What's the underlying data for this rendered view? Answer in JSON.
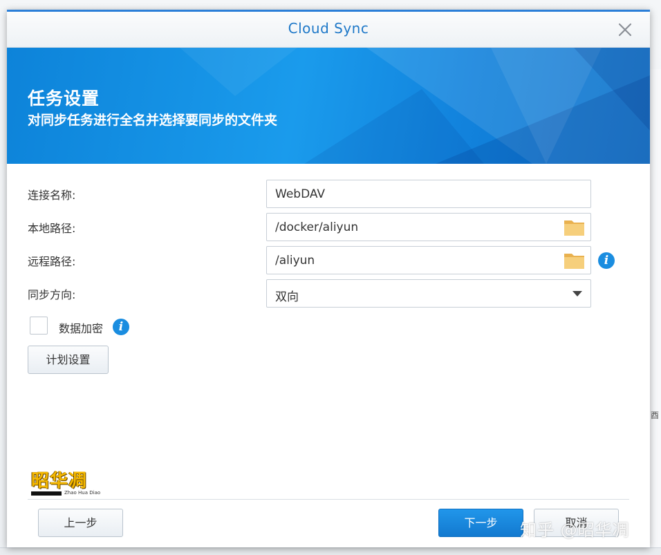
{
  "dialog": {
    "title": "Cloud Sync"
  },
  "banner": {
    "title": "任务设置",
    "subtitle": "对同步任务进行全名并选择要同步的文件夹"
  },
  "form": {
    "connection_name": {
      "label": "连接名称:",
      "value": "WebDAV"
    },
    "local_path": {
      "label": "本地路径:",
      "value": "/docker/aliyun"
    },
    "remote_path": {
      "label": "远程路径:",
      "value": "/aliyun"
    },
    "sync_direction": {
      "label": "同步方向:",
      "value": "双向"
    },
    "encrypt": {
      "label": "数据加密",
      "checked": false
    },
    "schedule_button": "计划设置"
  },
  "footer": {
    "prev_label": "上一步",
    "next_label": "下一步",
    "cancel_label": "取消"
  },
  "logo": {
    "mark": "昭华凋",
    "small": "Zhao Hua Diao"
  },
  "watermark": "知乎 @昭华凋",
  "background": {
    "right_glyph": "酉"
  },
  "colors": {
    "accent": "#1e78c8",
    "primary_button": "#1a88df",
    "banner": "#1283dd",
    "info": "#1a8de0",
    "folder": "#f2c46a"
  },
  "icons": {
    "close": "close-icon",
    "folder": "folder-icon",
    "info": "info-icon",
    "dropdown": "chevron-down-icon"
  }
}
